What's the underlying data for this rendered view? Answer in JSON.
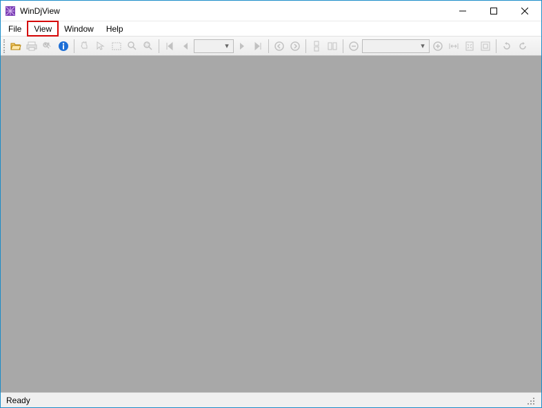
{
  "window": {
    "title": "WinDjView"
  },
  "menu": {
    "items": [
      {
        "label": "File",
        "highlighted": false
      },
      {
        "label": "View",
        "highlighted": true
      },
      {
        "label": "Window",
        "highlighted": false
      },
      {
        "label": "Help",
        "highlighted": false
      }
    ]
  },
  "toolbar": {
    "page_combo": "",
    "zoom_combo": ""
  },
  "status": {
    "text": "Ready"
  }
}
